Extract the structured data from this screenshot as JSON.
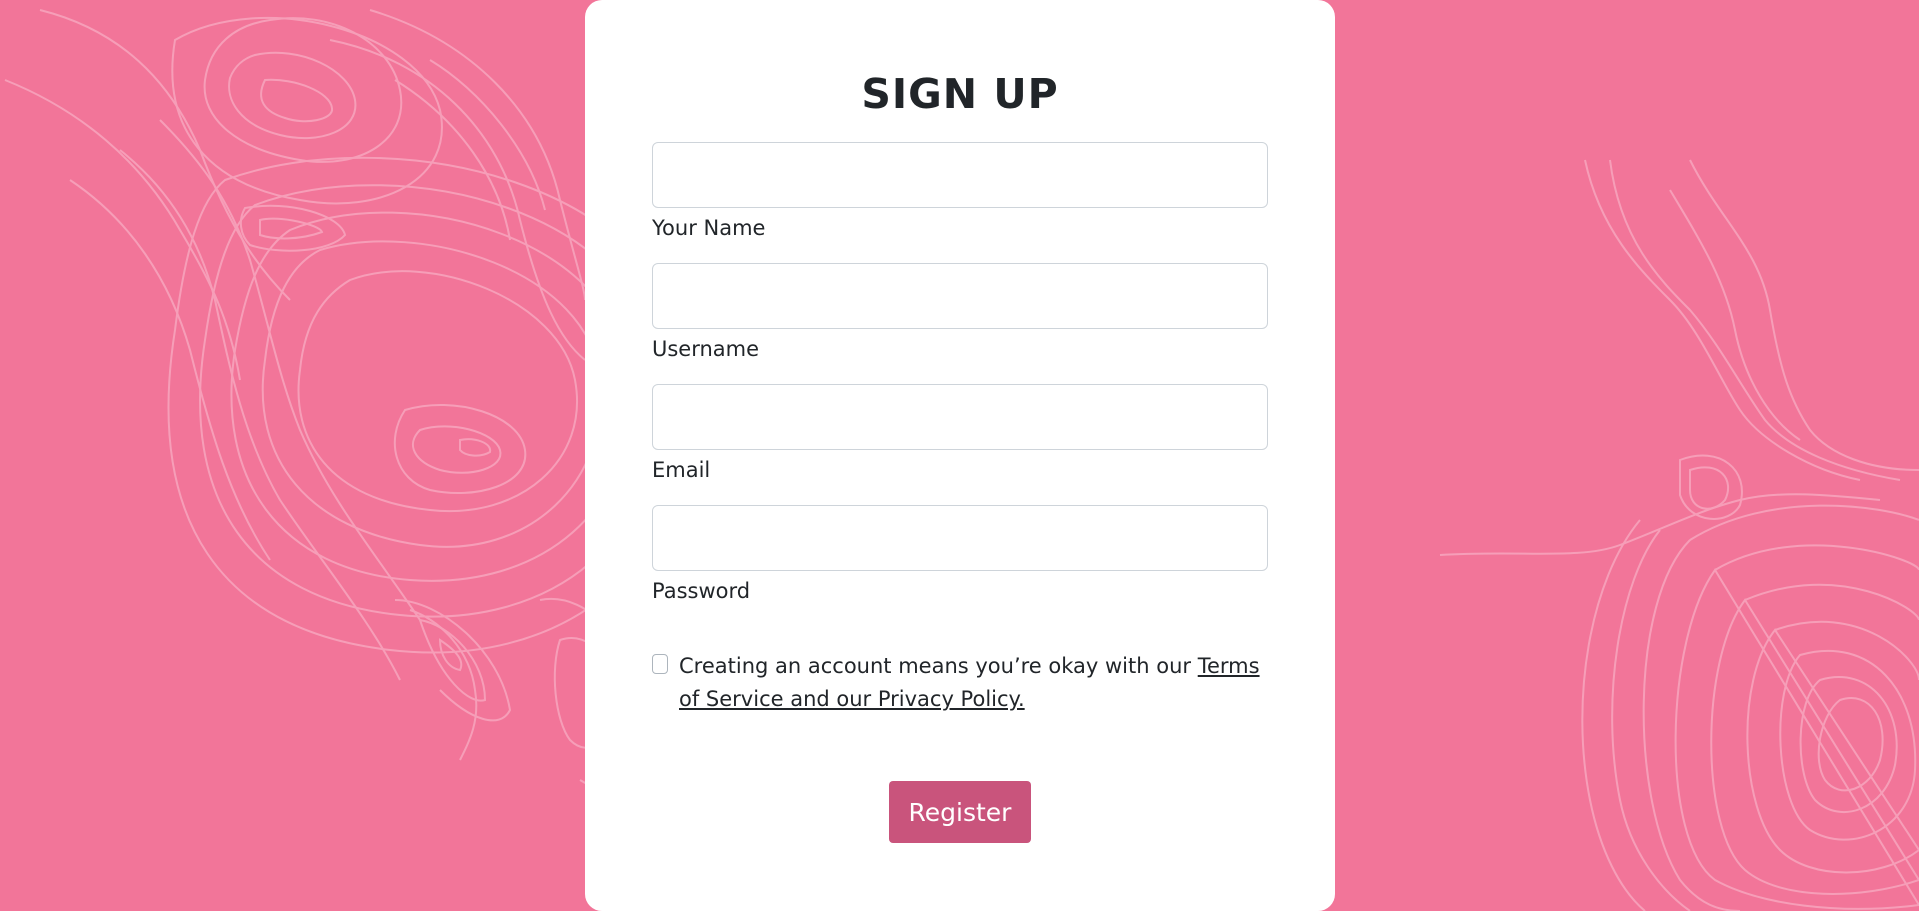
{
  "theme": {
    "background": "#f27599",
    "card": "#ffffff",
    "accent": "#c9547c",
    "pattern_line": "#f6a2bb"
  },
  "page": {
    "title": "SIGN UP"
  },
  "form": {
    "fields": [
      {
        "label": "Your Name",
        "value": "",
        "placeholder": ""
      },
      {
        "label": "Username",
        "value": "",
        "placeholder": ""
      },
      {
        "label": "Email",
        "value": "",
        "placeholder": ""
      },
      {
        "label": "Password",
        "value": "",
        "placeholder": ""
      }
    ],
    "consent": {
      "checked": false,
      "text": "Creating an account means you’re okay with our ",
      "link": "Terms of Service and our Privacy Policy."
    },
    "submit_label": "Register"
  },
  "decor": {
    "pattern": "topographic-contour-lines"
  }
}
